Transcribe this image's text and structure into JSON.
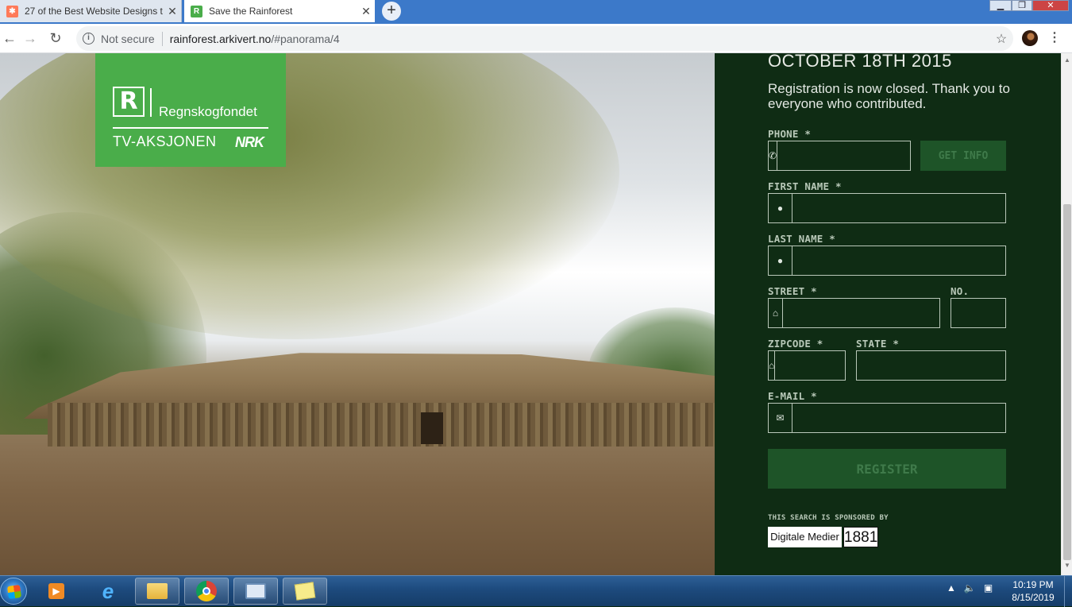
{
  "browser": {
    "tabs": [
      {
        "title": "27 of the Best Website Designs t",
        "favicon": "hubspot-icon",
        "favicon_color": "#ff7a59",
        "active": false
      },
      {
        "title": "Save the Rainforest",
        "favicon": "rainforest-r-icon",
        "favicon_color": "#4aad4a",
        "active": true
      }
    ],
    "security_label": "Not secure",
    "url_host": "rainforest.arkivert.no",
    "url_path": "/#panorama/4"
  },
  "logo": {
    "mark": "R",
    "org_name": "Regnskogfondet",
    "campaign": "TV-AKSJONEN",
    "broadcaster": "NRK",
    "bg_color": "#4aad4a"
  },
  "panel": {
    "bg_color": "#0f2c14",
    "date_heading": "OCTOBER 18TH 2015",
    "closed_message": "Registration is now closed. Thank you to everyone who contributed.",
    "fields": {
      "phone": {
        "label": "PHONE *",
        "value": "",
        "icon": "phone-icon"
      },
      "first_name": {
        "label": "FIRST NAME *",
        "value": "",
        "icon": "person-icon"
      },
      "last_name": {
        "label": "LAST NAME *",
        "value": "",
        "icon": "person-icon"
      },
      "street": {
        "label": "STREET *",
        "value": "",
        "icon": "home-icon"
      },
      "number": {
        "label": "NO.",
        "value": ""
      },
      "zipcode": {
        "label": "ZIPCODE *",
        "value": "",
        "icon": "home-icon"
      },
      "state": {
        "label": "STATE *",
        "value": ""
      },
      "email": {
        "label": "E-MAIL *",
        "value": "",
        "icon": "envelope-icon"
      }
    },
    "get_info_label": "GET INFO",
    "register_label": "REGISTER",
    "sponsor_text": "THIS SEARCH IS SPONSORED BY",
    "sponsor_name": "Digitale Medier",
    "sponsor_number": "1881"
  },
  "taskbar": {
    "apps": [
      "media-player-icon",
      "internet-explorer-icon",
      "file-explorer-icon",
      "chrome-icon",
      "remote-desktop-icon",
      "sticky-notes-icon"
    ],
    "time": "10:19 PM",
    "date": "8/15/2019"
  }
}
